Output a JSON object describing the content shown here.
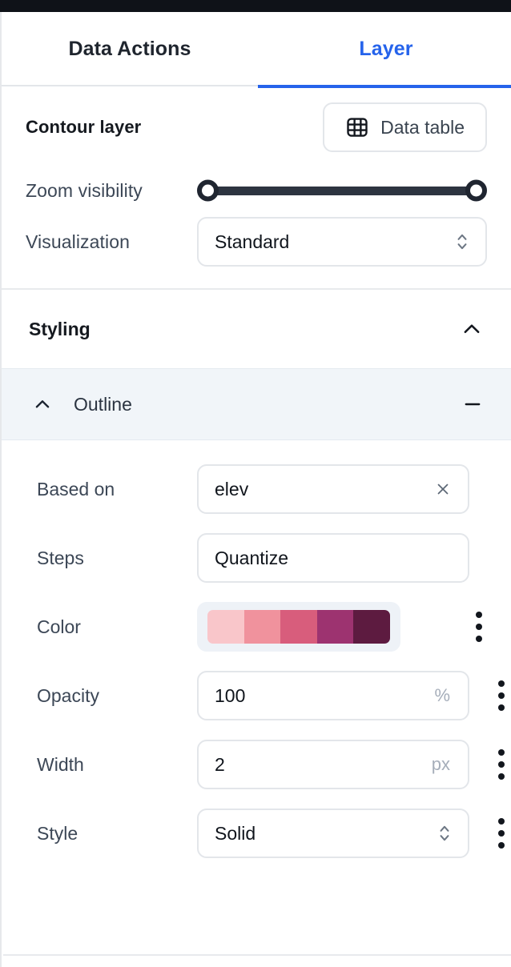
{
  "window": {
    "titlebar_color": "#0f1218"
  },
  "tabs": [
    {
      "label": "Data Actions",
      "active": false
    },
    {
      "label": "Layer",
      "active": true
    }
  ],
  "layer_panel": {
    "title": "Contour layer",
    "data_table_button": "Data table",
    "zoom_visibility": {
      "label": "Zoom visibility",
      "min_handle": "0",
      "max_handle": "100"
    },
    "visualization": {
      "label": "Visualization",
      "value": "Standard"
    }
  },
  "styling": {
    "title": "Styling",
    "expanded": true,
    "sections": [
      {
        "name": "Outline",
        "expanded": true,
        "properties": {
          "based_on": {
            "label": "Based on",
            "value": "elev"
          },
          "steps": {
            "label": "Steps",
            "value": "Quantize"
          },
          "color": {
            "label": "Color",
            "palette": [
              "#f9c6ca",
              "#f0929d",
              "#d85d7c",
              "#9d3370",
              "#5d1b40"
            ]
          },
          "opacity": {
            "label": "Opacity",
            "value": "100",
            "unit": "%"
          },
          "width": {
            "label": "Width",
            "value": "2",
            "unit": "px"
          },
          "style": {
            "label": "Style",
            "value": "Solid"
          }
        }
      }
    ]
  },
  "colors": {
    "accent": "#2563eb",
    "section_bg": "#f1f5f9",
    "border": "#e3e6ea",
    "text": "#3c4756"
  }
}
